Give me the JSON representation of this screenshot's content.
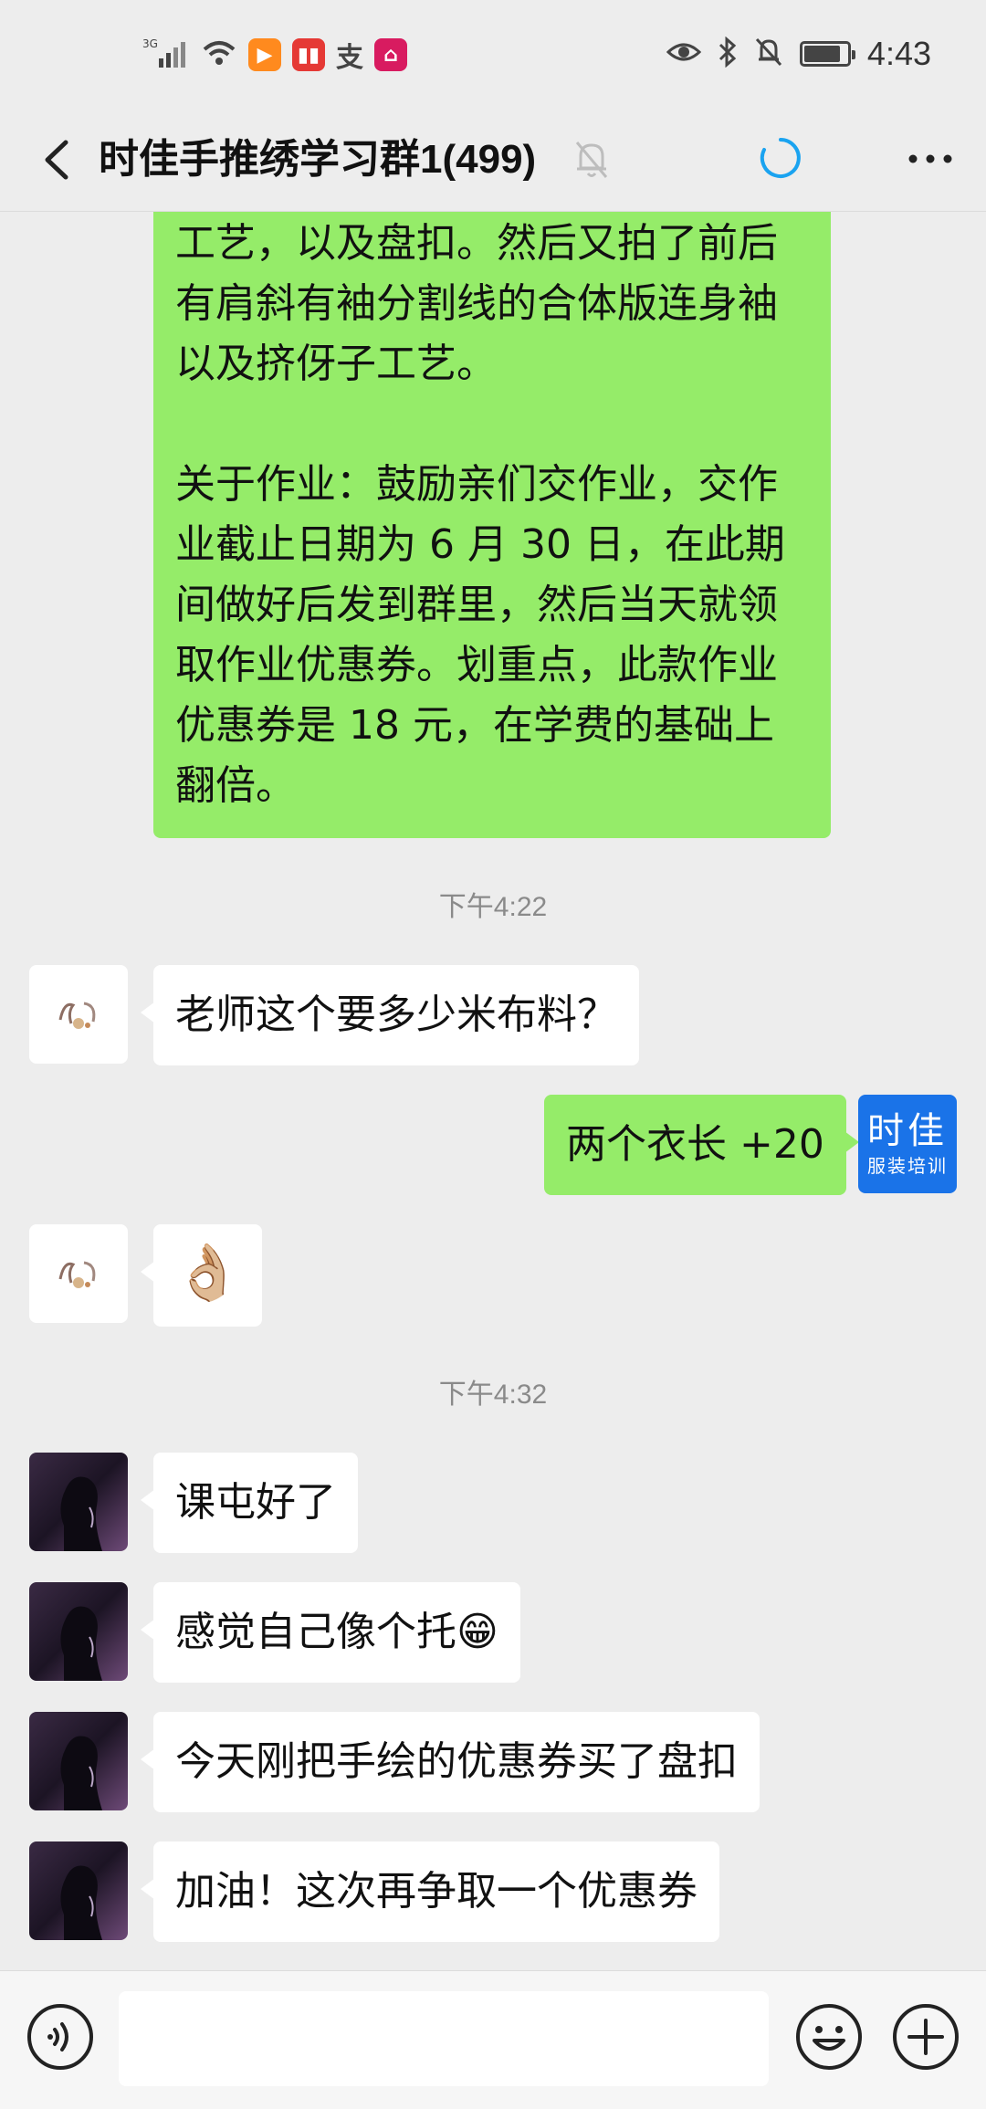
{
  "status_bar": {
    "signal": "3G",
    "time": "4:43",
    "battery_level": 0.85,
    "app_icons": [
      "video-app-icon",
      "book-app-icon",
      "alipay-icon",
      "shop-app-icon"
    ]
  },
  "header": {
    "title": "时佳手推绣学习群1(499)",
    "muted": true
  },
  "messages": {
    "long": {
      "sender": "self",
      "text": "工艺，以及盘扣。然后又拍了前后有肩斜有袖分割线的合体版连身袖以及挤伢子工艺。\n\n关于作业：鼓励亲们交作业，交作业截止日期为 6 月 30 日，在此期间做好后发到群里，然后当天就领取作业优惠券。划重点，此款作业优惠券是 18 元，在学费的基础上翻倍。"
    },
    "time1": "下午4:22",
    "m1": "老师这个要多少米布料？",
    "m2": "两个衣长 +20",
    "m3": "👌🏼",
    "time2": "下午4:32",
    "m4": "课屯好了",
    "m5": "感觉自己像个托😁",
    "m6": "今天刚把手绘的优惠券买了盘扣",
    "m7": "加油！这次再争取一个优惠券"
  },
  "self_avatar": {
    "line1": "时佳",
    "line2": "服装培训"
  },
  "colors": {
    "self_bubble": "#95ec69",
    "other_bubble": "#ffffff",
    "background": "#ededed",
    "self_avatar_bg": "#1a73e8",
    "loading_accent": "#1aa3f0"
  },
  "icons": {
    "back": "chevron-left-icon",
    "mute": "bell-off-icon",
    "loading": "loading-spinner-icon",
    "more": "more-dots-icon",
    "voice": "voice-input-icon",
    "emoji": "emoji-icon",
    "plus": "plus-icon"
  }
}
